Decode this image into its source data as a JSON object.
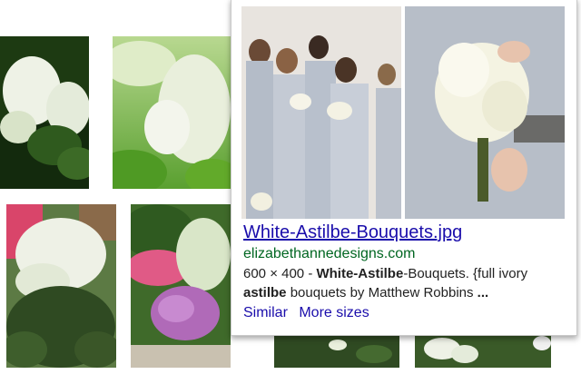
{
  "thumbnails": [
    {
      "name": "white-astilbe-plant-thumbnail"
    },
    {
      "name": "astilbe-closeup-thumbnail"
    },
    {
      "name": "white-astilbe-garden-thumbnail"
    },
    {
      "name": "pink-astilbe-garden-thumbnail"
    },
    {
      "name": "bottom-row-thumbnail-1"
    },
    {
      "name": "bottom-row-thumbnail-2"
    }
  ],
  "preview": {
    "title": "White-Astilbe-Bouquets.jpg",
    "domain": "elizabethannedesigns.com",
    "desc_dims": "600 × 400 - ",
    "desc_bold1": "White-Astilbe",
    "desc_mid": "-Bouquets. {full ivory ",
    "desc_bold2": "astilbe",
    "desc_tail": " bouquets by Matthew Robbins ",
    "desc_ellipsis": "...",
    "links": {
      "similar": "Similar",
      "more_sizes": "More sizes"
    }
  },
  "colors": {
    "link": "#1a0dab",
    "domain": "#006621",
    "text": "#222222"
  }
}
